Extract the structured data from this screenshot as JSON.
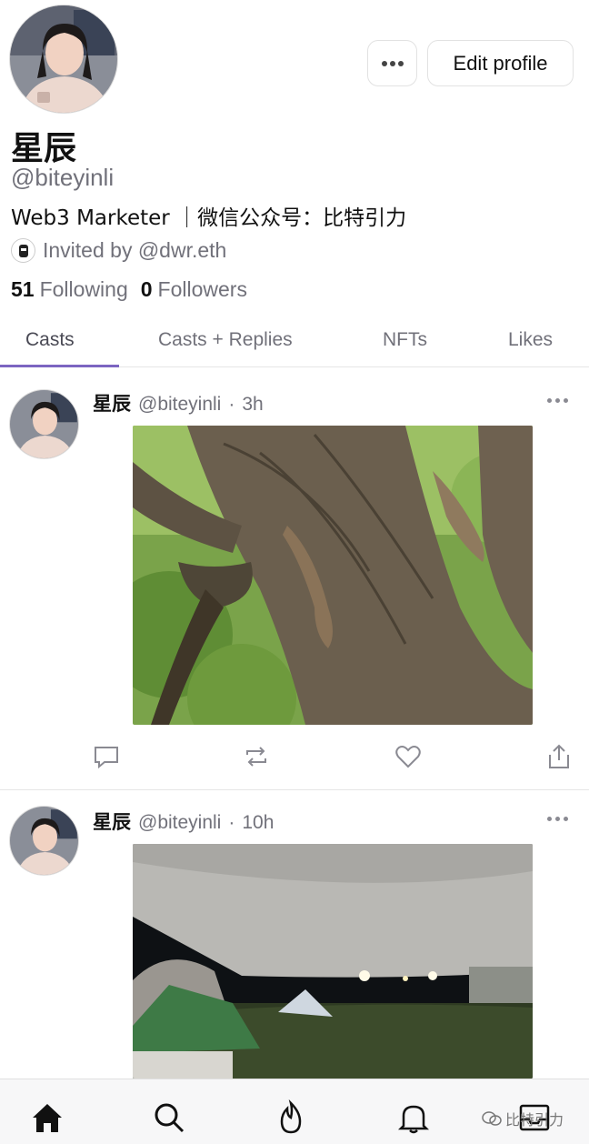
{
  "profile": {
    "display_name": "星辰",
    "handle": "@biteyinli",
    "bio": "Web3 Marketer ｜微信公众号：比特引力",
    "invited_text": "Invited by @dwr.eth",
    "following_count": "51",
    "following_label": "Following",
    "followers_count": "0",
    "followers_label": "Followers",
    "edit_profile_label": "Edit profile"
  },
  "tabs": [
    {
      "label": "Casts",
      "active": true
    },
    {
      "label": "Casts + Replies",
      "active": false
    },
    {
      "label": "NFTs",
      "active": false
    },
    {
      "label": "Likes",
      "active": false
    }
  ],
  "casts": [
    {
      "name": "星辰",
      "handle": "@biteyinli",
      "sep": "·",
      "time": "3h",
      "image": "squirrels-on-tree-trunk"
    },
    {
      "name": "星辰",
      "handle": "@biteyinli",
      "sep": "·",
      "time": "10h",
      "image": "night-campsite-tents"
    }
  ],
  "nav": {
    "items": [
      "home-icon",
      "search-icon",
      "flame-icon",
      "bell-icon",
      "inbox-icon"
    ]
  },
  "watermark": "比特引力",
  "colors": {
    "accent": "#7c65c1",
    "muted": "#71717a"
  }
}
